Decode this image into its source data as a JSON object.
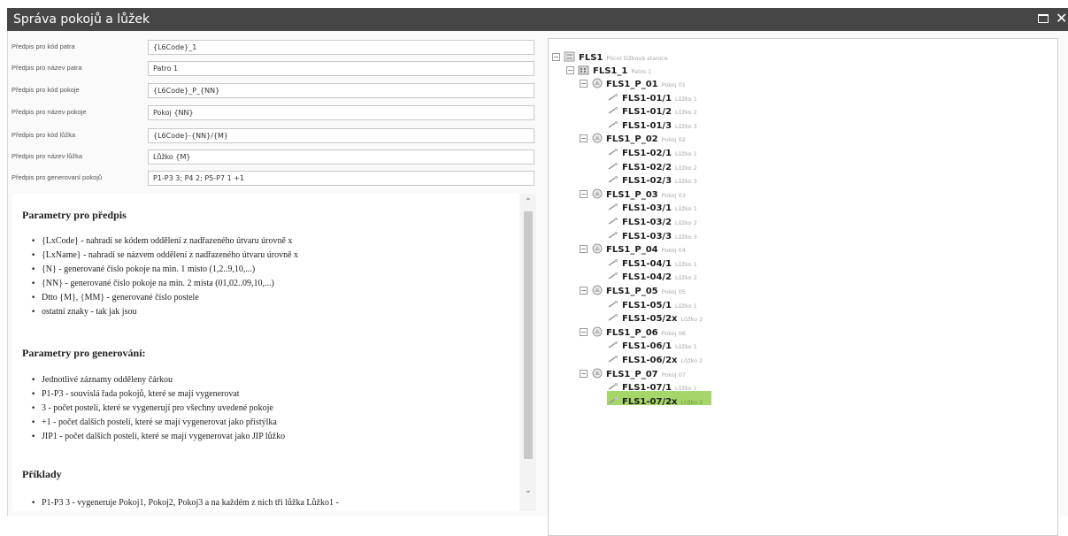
{
  "window": {
    "title": "Správa pokojů a lůžek"
  },
  "form": {
    "fields": [
      {
        "label": "Předpis pro kód patra",
        "value": "{L6Code}_1"
      },
      {
        "label": "Předpis pro název patra",
        "value": "Patro 1"
      },
      {
        "label": "Předpis pro kód pokoje",
        "value": "{L6Code}_P_{NN}"
      },
      {
        "label": "Předpis pro název pokoje",
        "value": "Pokoj {NN}"
      },
      {
        "label": "Předpis pro kód lůžka",
        "value": "{L6Code}-{NN}/{M}"
      },
      {
        "label": "Předpis pro název lůžka",
        "value": "Lůžko {M}"
      },
      {
        "label": "Předpis pro generovaní pokojů",
        "value": "P1-P3 3; P4 2; P5-P7 1 +1"
      }
    ]
  },
  "help": {
    "sections": [
      {
        "heading": "Parametry pro předpis",
        "items": [
          "{LxCode} - nahradí se kódem oddělení z nadřazeného útvaru úrovně x",
          "{LxName} - nahradí se názvem oddělení z nadřazeného útvaru úrovně x",
          "{N} - generované číslo pokoje na min. 1 místo (1,2..9,10,...)",
          "{NN} - generované číslo pokoje na min. 2 místa (01,02..09,10,...)",
          "Dtto {M}, {MM} - generované číslo postele",
          "ostatní znaky - tak jak jsou"
        ]
      },
      {
        "heading": "Parametry pro generování:",
        "items": [
          "Jednotlivé záznamy odděleny čárkou",
          "P1-P3 - souvislá řada pokojů, které se mají vygenerovat",
          "3 - počet postelí, které se vygenerují pro všechny uvedené pokoje",
          "+1 - počet dalších postelí, které se mají vygenerovat jako přistýlka",
          "JIP1 - počet dalších postelí, které se mají vygenerovat jako JIP lůžko"
        ]
      },
      {
        "heading": "Příklady",
        "items": [
          "P1-P3 3 - vygeneruje Pokoj1, Pokoj2, Pokoj3 a na každém z nich tři lůžka Lůžko1 -"
        ]
      }
    ]
  },
  "tree": {
    "root": {
      "code": "FLS1",
      "name": "Plicní lůžková stanice",
      "toggle": "⊟"
    },
    "floor": {
      "code": "FLS1_1",
      "name": "Patro 1",
      "toggle": "⊟"
    },
    "rooms": [
      {
        "code": "FLS1_P_01",
        "name": "Pokoj 01",
        "toggle": "⊟",
        "beds": [
          {
            "code": "FLS1-01/1",
            "name": "Lůžko 1"
          },
          {
            "code": "FLS1-01/2",
            "name": "Lůžko 2"
          },
          {
            "code": "FLS1-01/3",
            "name": "Lůžko 3"
          }
        ]
      },
      {
        "code": "FLS1_P_02",
        "name": "Pokoj 02",
        "toggle": "⊟",
        "beds": [
          {
            "code": "FLS1-02/1",
            "name": "Lůžko 1"
          },
          {
            "code": "FLS1-02/2",
            "name": "Lůžko 2"
          },
          {
            "code": "FLS1-02/3",
            "name": "Lůžko 3"
          }
        ]
      },
      {
        "code": "FLS1_P_03",
        "name": "Pokoj 03",
        "toggle": "⊟",
        "beds": [
          {
            "code": "FLS1-03/1",
            "name": "Lůžko 1"
          },
          {
            "code": "FLS1-03/2",
            "name": "Lůžko 2"
          },
          {
            "code": "FLS1-03/3",
            "name": "Lůžko 3"
          }
        ]
      },
      {
        "code": "FLS1_P_04",
        "name": "Pokoj 04",
        "toggle": "⊟",
        "beds": [
          {
            "code": "FLS1-04/1",
            "name": "Lůžko 1"
          },
          {
            "code": "FLS1-04/2",
            "name": "Lůžko 2"
          }
        ]
      },
      {
        "code": "FLS1_P_05",
        "name": "Pokoj 05",
        "toggle": "⊟",
        "beds": [
          {
            "code": "FLS1-05/1",
            "name": "Lůžko 1"
          },
          {
            "code": "FLS1-05/2x",
            "name": "Lůžko 2"
          }
        ]
      },
      {
        "code": "FLS1_P_06",
        "name": "Pokoj 06",
        "toggle": "⊟",
        "beds": [
          {
            "code": "FLS1-06/1",
            "name": "Lůžko 1"
          },
          {
            "code": "FLS1-06/2x",
            "name": "Lůžko 2"
          }
        ]
      },
      {
        "code": "FLS1_P_07",
        "name": "Pokoj 07",
        "toggle": "⊟",
        "beds": [
          {
            "code": "FLS1-07/1",
            "name": "Lůžko 1"
          },
          {
            "code": "FLS1-07/2x",
            "name": "Lůžko 2",
            "selected": true
          }
        ]
      }
    ]
  },
  "colors": {
    "titlebar": "#464646",
    "selection": "#a6d66a"
  },
  "icons": {
    "maximize": "maximize-icon",
    "close": "close-icon",
    "scroll_up": "chevron-up-icon",
    "scroll_down": "chevron-down-icon",
    "department": "department-icon",
    "floor": "building-icon",
    "room": "room-icon",
    "bed": "bed-icon"
  },
  "scroll": {
    "up": "⌃",
    "down": "⌄"
  },
  "window_controls": {
    "close": "✕"
  }
}
